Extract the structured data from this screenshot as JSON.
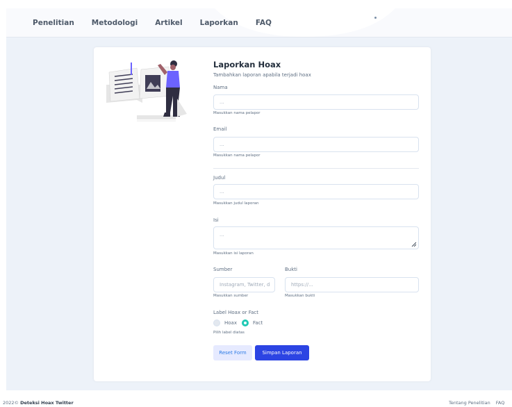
{
  "nav": {
    "items": [
      {
        "label": "Penelitian"
      },
      {
        "label": "Metodologi"
      },
      {
        "label": "Artikel"
      },
      {
        "label": "Laporkan"
      },
      {
        "label": "FAQ"
      }
    ]
  },
  "form": {
    "title": "Laporkan Hoax",
    "subtitle": "Tambahkan laporan apabila terjadi hoax",
    "nama": {
      "label": "Nama",
      "placeholder": "...",
      "help": "Masukkan nama pelapor"
    },
    "email": {
      "label": "Email",
      "placeholder": "...",
      "help": "Masukkan nama pelapor"
    },
    "judul": {
      "label": "Judul",
      "placeholder": "...",
      "help": "Masukkan judul laporan"
    },
    "isi": {
      "label": "Isi",
      "placeholder": "...",
      "help": "Masukkan isi laporan"
    },
    "sumber": {
      "label": "Sumber",
      "placeholder": "Instagram, Twitter, d",
      "help": "Masukkan sumber"
    },
    "bukti": {
      "label": "Bukti",
      "placeholder": "https://...",
      "help": "Masukkan bukti"
    },
    "label_group": {
      "label": "Label Hoax or Fact",
      "options": [
        {
          "label": "Hoax",
          "checked": false
        },
        {
          "label": "Fact",
          "checked": true
        }
      ],
      "help": "Pilih label diatas"
    },
    "reset_label": "Reset Form",
    "save_label": "Simpan Laporan"
  },
  "footer": {
    "copyright": "2022©",
    "brand": "Deteksi Hoax Twitter",
    "links": [
      "Tentang Penelitian",
      "FAQ"
    ]
  },
  "colors": {
    "accent": "#2c44e3",
    "radio_checked": "#1fc9b4",
    "background": "#edf2f9"
  }
}
